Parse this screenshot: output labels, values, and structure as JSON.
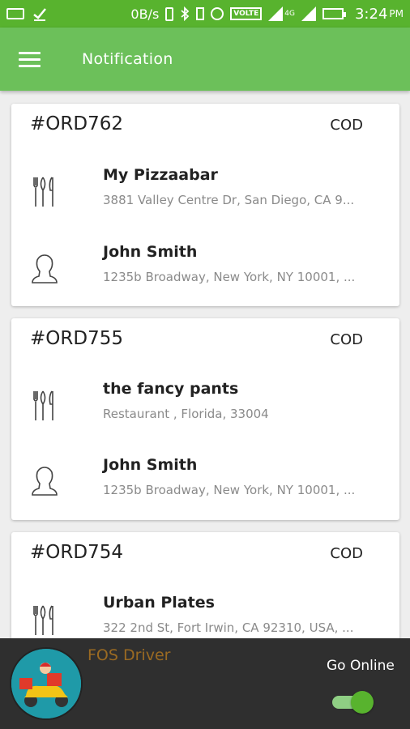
{
  "status_bar": {
    "net_speed": "0B/s",
    "network_4g": "4G",
    "volte": "VOLTE",
    "time": "3:24",
    "ampm": "PM"
  },
  "app_bar": {
    "title": "Notification",
    "menu_icon": "menu-icon"
  },
  "orders": [
    {
      "id": "#ORD762",
      "payment": "COD",
      "restaurant": {
        "name": "My Pizzaabar",
        "address": "3881 Valley Centre Dr, San Diego, CA 9..."
      },
      "customer": {
        "name": "John Smith",
        "address": "1235b Broadway, New York, NY 10001, ..."
      }
    },
    {
      "id": "#ORD755",
      "payment": "COD",
      "restaurant": {
        "name": "the fancy pants",
        "address": "Restaurant , Florida, 33004"
      },
      "customer": {
        "name": "John Smith",
        "address": "1235b Broadway, New York, NY 10001, ..."
      }
    },
    {
      "id": "#ORD754",
      "payment": "COD",
      "restaurant": {
        "name": "Urban Plates",
        "address": "322 2nd St, Fort Irwin, CA 92310, USA, ..."
      },
      "customer": {
        "name": "",
        "address": ""
      }
    }
  ],
  "bottom_bar": {
    "driver_name": "FOS Driver",
    "go_online_label": "Go Online",
    "online": true
  },
  "colors": {
    "status_bar": "#58b32e",
    "app_bar": "#6cc05a",
    "bottom_bar": "#2f2f2f",
    "driver_name": "#9a6a22"
  }
}
